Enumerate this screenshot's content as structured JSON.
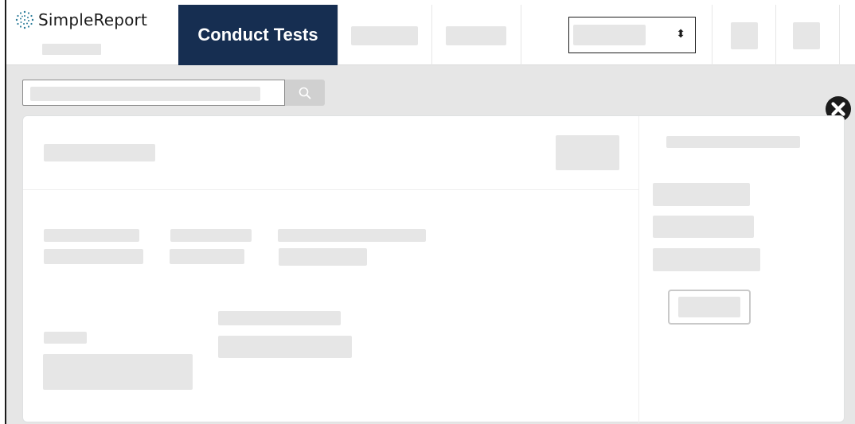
{
  "app": {
    "name": "SimpleReport",
    "logo_icon": "simplereport-dots-icon"
  },
  "nav": {
    "active_label": "Conduct Tests"
  },
  "facility_select": {
    "arrow_glyph": "⬍"
  },
  "icons": {
    "search": "search-icon",
    "close": "close-icon"
  },
  "colors": {
    "nav_active_bg": "#162e51",
    "nav_active_text": "#ffffff",
    "placeholder": "#e6e6e6",
    "page_bg": "#e6e6e6",
    "logo_accent": "#2e7d9a"
  }
}
